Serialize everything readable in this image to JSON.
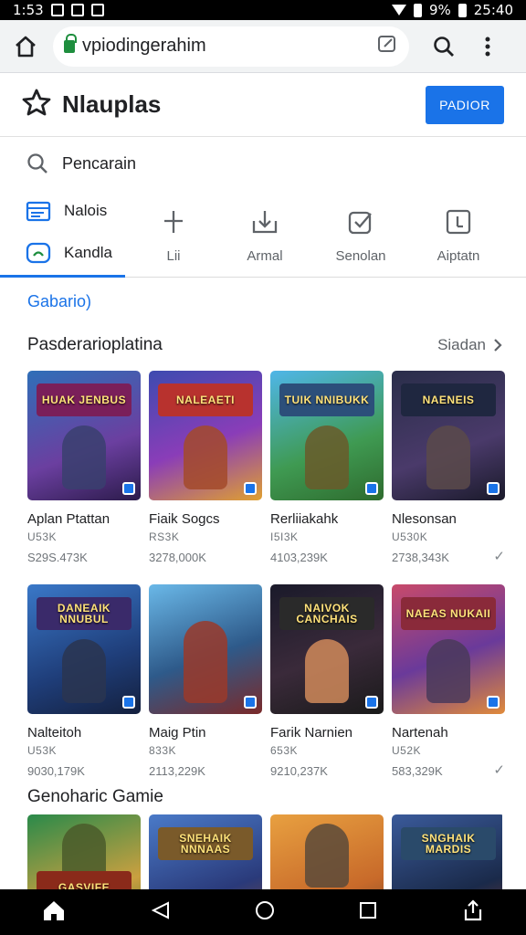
{
  "status_bar": {
    "time": "1:53",
    "right_text": "9%",
    "clock": "25:40"
  },
  "browser": {
    "url": "vpiodingerahim"
  },
  "header": {
    "title": "Nlauplas",
    "button_label": "PADIOR"
  },
  "search": {
    "label": "Pencarain"
  },
  "nav": {
    "left_items": [
      "Nalois",
      "Kandla"
    ],
    "tabs": [
      "Lii",
      "Armal",
      "Senolan",
      "Aiptatn"
    ]
  },
  "section_blue": "Gabario)",
  "section1": {
    "title": "Pasderarioplatina",
    "see_all": "Siadan"
  },
  "row1": [
    {
      "title": "Aplan Ptattan",
      "sub": "U53K",
      "meta": "S29S.473K",
      "logo": "HUAK JENBUS"
    },
    {
      "title": "Fiaik Sogcs",
      "sub": "RS3K",
      "meta": "3278,000K",
      "logo": "NALEAETI"
    },
    {
      "title": "Rerliiakahk",
      "sub": "I5I3K",
      "meta": "4103,239K",
      "logo": "TUIK NNIBUKK"
    },
    {
      "title": "Nlesonsan",
      "sub": "U530K",
      "meta": "2738,343K",
      "logo": "NAENEIS"
    }
  ],
  "row2": [
    {
      "title": "Nalteitoh",
      "sub": "U53K",
      "meta": "9030,179K",
      "logo": "DANEAIK NNUBUL"
    },
    {
      "title": "Maig Ptin",
      "sub": "833K",
      "meta": "2113,229K",
      "logo": ""
    },
    {
      "title": "Farik Narnien",
      "sub": "653K",
      "meta": "9210,237K",
      "logo": "NAIVOK CANCHAIS"
    },
    {
      "title": "Nartenah",
      "sub": "U52K",
      "meta": "583,329K",
      "logo": "NAEAS NUKAII"
    }
  ],
  "section2": {
    "title": "Genoharic Gamie"
  },
  "row3": [
    {
      "logo": "GASVIFE"
    },
    {
      "logo": "SNEHAIK NNNAAS"
    },
    {
      "logo": ""
    },
    {
      "logo": "SNGHAIK MARDIS"
    }
  ],
  "colors": {
    "accent": "#1a73e8",
    "lock": "#1e8e3e"
  },
  "icons": {
    "home": "home-icon",
    "search": "search-icon",
    "menu": "more-vert-icon",
    "star": "star-outline-icon",
    "nav_back": "back-triangle-icon",
    "nav_home": "circle-icon",
    "nav_recent": "square-icon",
    "share": "share-icon"
  }
}
